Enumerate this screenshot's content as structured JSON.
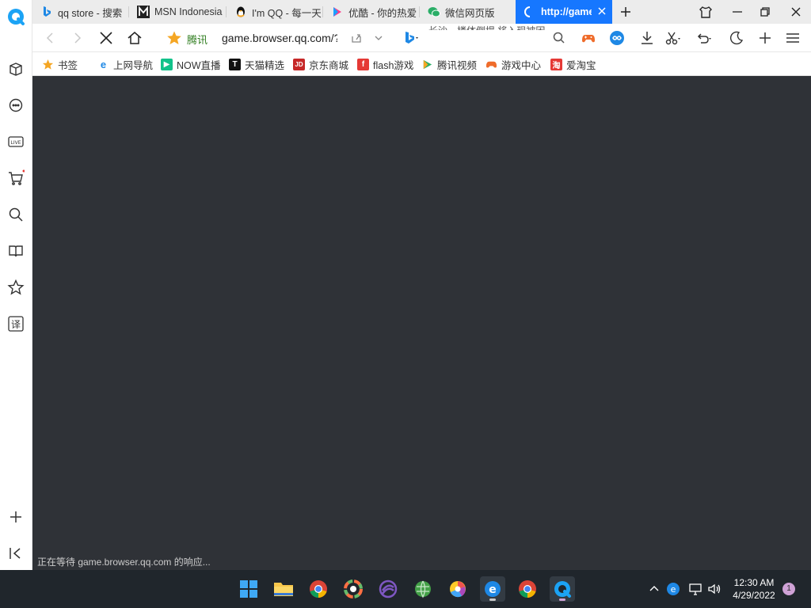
{
  "tabs": [
    {
      "title": "qq store - 搜索"
    },
    {
      "title": "MSN Indonesia"
    },
    {
      "title": "I'm QQ - 每一天"
    },
    {
      "title": "优酷 - 你的热爱"
    },
    {
      "title": "微信网页版"
    },
    {
      "title": "http://game.browser.qq.com"
    }
  ],
  "navbar": {
    "brand_label": "腾讯",
    "url": "game.browser.qq.com/?",
    "hint_text": "长沙一楼体倒塌 将入现被困"
  },
  "bookmarks": [
    {
      "label": "书签",
      "icon": "star-icon"
    },
    {
      "label": "上网导航",
      "icon": "ie-icon"
    },
    {
      "label": "NOW直播",
      "icon": "now-icon"
    },
    {
      "label": "天猫精选",
      "icon": "tmall-icon"
    },
    {
      "label": "京东商城",
      "icon": "jd-icon"
    },
    {
      "label": "flash游戏",
      "icon": "flash-icon"
    },
    {
      "label": "腾讯视频",
      "icon": "tencent-video-icon"
    },
    {
      "label": "游戏中心",
      "icon": "gamepad-icon"
    },
    {
      "label": "爱淘宝",
      "icon": "taobao-icon"
    }
  ],
  "status_text": "正在等待 game.browser.qq.com 的响应...",
  "clock": {
    "time": "12:30 AM",
    "date": "4/29/2022"
  },
  "notification_count": "1",
  "colors": {
    "accent": "#1677ff",
    "content_bg": "#2f3237",
    "taskbar_bg": "#20262c"
  }
}
